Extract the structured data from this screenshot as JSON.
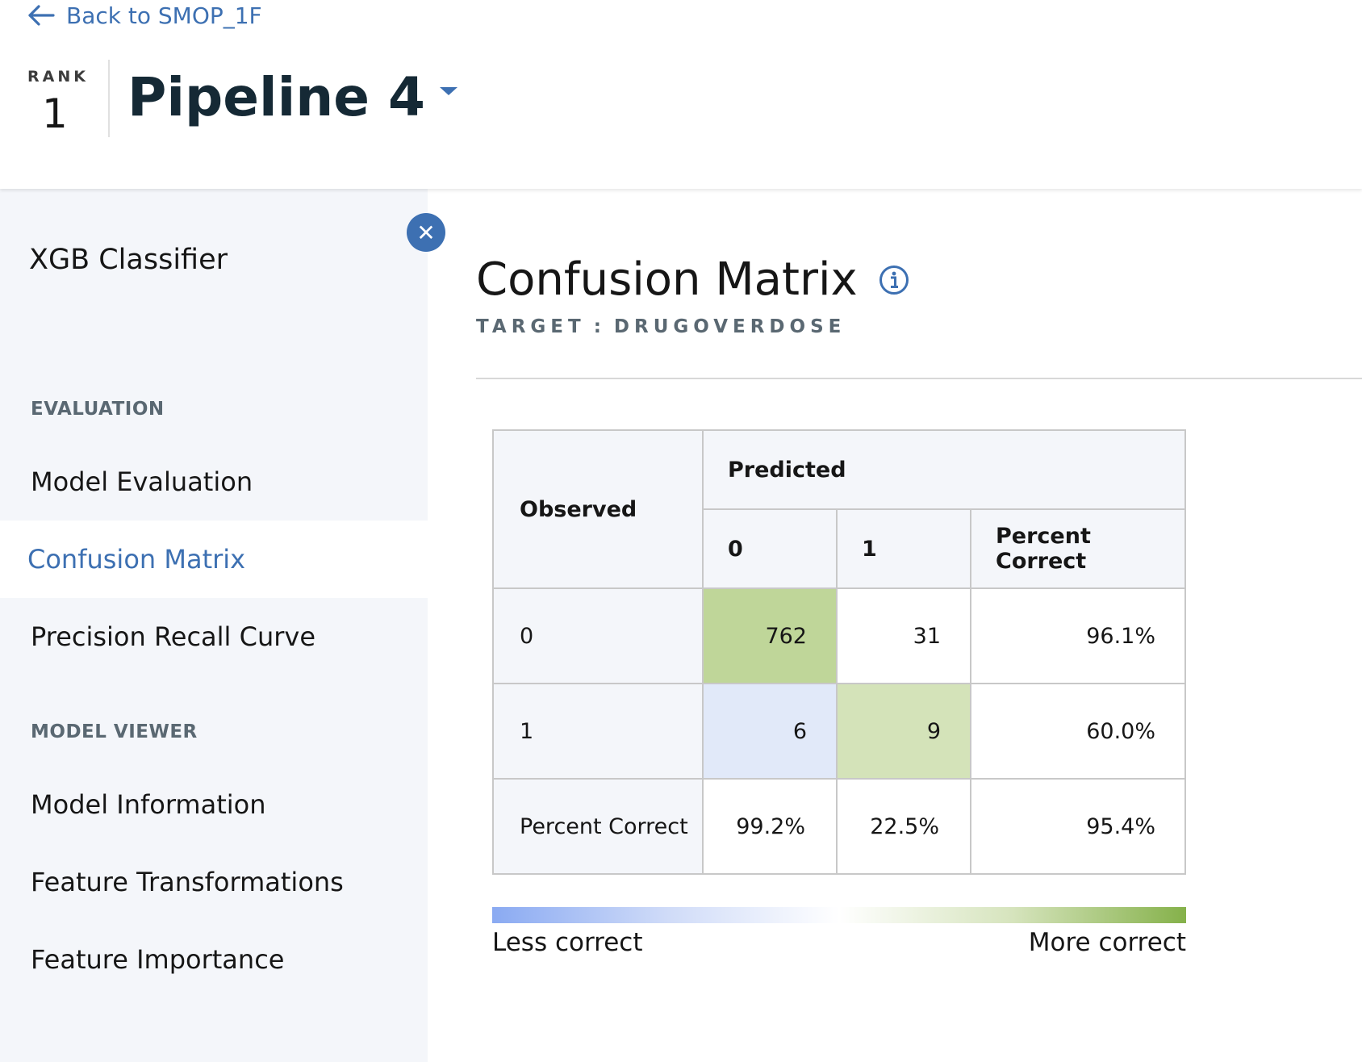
{
  "header": {
    "back_label": "Back to SMOP_1F",
    "rank_label": "RANK",
    "rank_value": "1",
    "pipeline_title": "Pipeline 4"
  },
  "sidebar": {
    "title": "XGB Classifier",
    "sections": [
      {
        "label": "EVALUATION",
        "items": [
          "Model Evaluation",
          "Confusion Matrix",
          "Precision Recall Curve"
        ]
      },
      {
        "label": "MODEL VIEWER",
        "items": [
          "Model Information",
          "Feature Transformations",
          "Feature Importance"
        ]
      }
    ],
    "active_item": "Confusion Matrix"
  },
  "main": {
    "title": "Confusion Matrix",
    "target_prefix": "TARGET",
    "target_sep": ":",
    "target_value": "DRUGOVERDOSE"
  },
  "matrix": {
    "observed_label": "Observed",
    "predicted_label": "Predicted",
    "columns": [
      "0",
      "1",
      "Percent Correct"
    ],
    "rows": [
      {
        "label": "0",
        "cells": [
          "762",
          "31",
          "96.1%"
        ]
      },
      {
        "label": "1",
        "cells": [
          "6",
          "9",
          "60.0%"
        ]
      },
      {
        "label": "Percent Correct",
        "cells": [
          "99.2%",
          "22.5%",
          "95.4%"
        ]
      }
    ]
  },
  "legend": {
    "less": "Less correct",
    "more": "More correct"
  },
  "colors": {
    "accent": "#3d70b2",
    "cell_green_strong": "#bfd699",
    "cell_green_light": "#d4e3b9",
    "cell_blue_light": "#e1e9f9"
  }
}
